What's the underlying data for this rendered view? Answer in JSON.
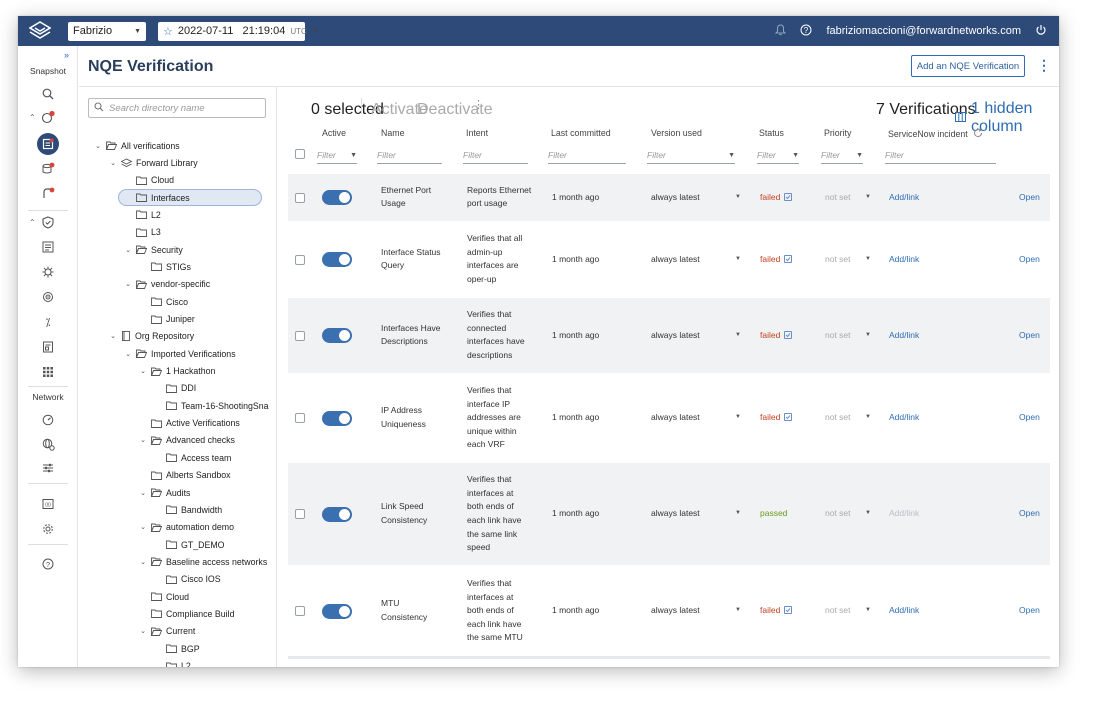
{
  "topbar": {
    "org": "Fabrizio",
    "snapshot_datetime": "2022-07-11   21:19:04",
    "snapshot_tz": "UTC",
    "user_email": "fabriziomaccioni@forwardnetworks.com"
  },
  "leftnav": {
    "snapshot_label": "Snapshot",
    "network_label": "Network"
  },
  "page": {
    "title": "NQE Verification",
    "add_button": "Add an NQE Verification"
  },
  "tree": {
    "search_placeholder": "Search directory name",
    "items": [
      {
        "label": "All verifications",
        "depth": 0,
        "chev": "down",
        "icon": "folder-open"
      },
      {
        "label": "Forward Library",
        "depth": 1,
        "chev": "down",
        "icon": "library"
      },
      {
        "label": "Cloud",
        "depth": 2,
        "chev": "",
        "icon": "folder"
      },
      {
        "label": "Interfaces",
        "depth": 2,
        "chev": "",
        "icon": "folder",
        "selected": true
      },
      {
        "label": "L2",
        "depth": 2,
        "chev": "",
        "icon": "folder"
      },
      {
        "label": "L3",
        "depth": 2,
        "chev": "",
        "icon": "folder"
      },
      {
        "label": "Security",
        "depth": 2,
        "chev": "down",
        "icon": "folder-open"
      },
      {
        "label": "STIGs",
        "depth": 3,
        "chev": "",
        "icon": "folder"
      },
      {
        "label": "vendor-specific",
        "depth": 2,
        "chev": "down",
        "icon": "folder-open"
      },
      {
        "label": "Cisco",
        "depth": 3,
        "chev": "",
        "icon": "folder"
      },
      {
        "label": "Juniper",
        "depth": 3,
        "chev": "",
        "icon": "folder"
      },
      {
        "label": "Org Repository",
        "depth": 1,
        "chev": "down",
        "icon": "repo"
      },
      {
        "label": "Imported Verifications",
        "depth": 2,
        "chev": "down",
        "icon": "folder-open"
      },
      {
        "label": "1 Hackathon",
        "depth": 3,
        "chev": "down",
        "icon": "folder-open"
      },
      {
        "label": "DDI",
        "depth": 4,
        "chev": "",
        "icon": "folder"
      },
      {
        "label": "Team-16-ShootingSna",
        "depth": 4,
        "chev": "",
        "icon": "folder"
      },
      {
        "label": "Active Verifications",
        "depth": 3,
        "chev": "",
        "icon": "folder"
      },
      {
        "label": "Advanced checks",
        "depth": 3,
        "chev": "down",
        "icon": "folder-open"
      },
      {
        "label": "Access team",
        "depth": 4,
        "chev": "",
        "icon": "folder"
      },
      {
        "label": "Alberts Sandbox",
        "depth": 3,
        "chev": "",
        "icon": "folder"
      },
      {
        "label": "Audits",
        "depth": 3,
        "chev": "down",
        "icon": "folder-open"
      },
      {
        "label": "Bandwidth",
        "depth": 4,
        "chev": "",
        "icon": "folder"
      },
      {
        "label": "automation demo",
        "depth": 3,
        "chev": "down",
        "icon": "folder-open"
      },
      {
        "label": "GT_DEMO",
        "depth": 4,
        "chev": "",
        "icon": "folder"
      },
      {
        "label": "Baseline access networks",
        "depth": 3,
        "chev": "down",
        "icon": "folder-open"
      },
      {
        "label": "Cisco IOS",
        "depth": 4,
        "chev": "",
        "icon": "folder"
      },
      {
        "label": "Cloud",
        "depth": 3,
        "chev": "",
        "icon": "folder"
      },
      {
        "label": "Compliance Build",
        "depth": 3,
        "chev": "",
        "icon": "folder"
      },
      {
        "label": "Current",
        "depth": 3,
        "chev": "down",
        "icon": "folder-open"
      },
      {
        "label": "BGP",
        "depth": 4,
        "chev": "",
        "icon": "folder"
      },
      {
        "label": "L2",
        "depth": 4,
        "chev": "",
        "icon": "folder"
      }
    ]
  },
  "toolbar": {
    "selected": "0 selected",
    "activate": "Activate",
    "deactivate": "Deactivate",
    "count": "7 Verifications",
    "hidden_columns": "1 hidden column"
  },
  "table": {
    "headers": {
      "active": "Active",
      "name": "Name",
      "intent": "Intent",
      "last_committed": "Last committed",
      "version_used": "Version used",
      "status": "Status",
      "priority": "Priority",
      "servicenow": "ServiceNow incident"
    },
    "filter_placeholder": "Filter",
    "rows": [
      {
        "name": [
          "Ethernet Port",
          "Usage"
        ],
        "intent": [
          "Reports Ethernet",
          "port usage"
        ],
        "last": "1 month ago",
        "version": "always latest",
        "status": "failed",
        "priority": "not set",
        "incident": "Add/link",
        "open": "Open"
      },
      {
        "name": [
          "Interface Status",
          "Query"
        ],
        "intent": [
          "Verifies that all",
          "admin-up",
          "interfaces are",
          "oper-up"
        ],
        "last": "1 month ago",
        "version": "always latest",
        "status": "failed",
        "priority": "not set",
        "incident": "Add/link",
        "open": "Open"
      },
      {
        "name": [
          "Interfaces Have",
          "Descriptions"
        ],
        "intent": [
          "Verifies that",
          "connected",
          "interfaces have",
          "descriptions"
        ],
        "last": "1 month ago",
        "version": "always latest",
        "status": "failed",
        "priority": "not set",
        "incident": "Add/link",
        "open": "Open"
      },
      {
        "name": [
          "IP Address",
          "Uniqueness"
        ],
        "intent": [
          "Verifies that",
          "interface IP",
          "addresses are",
          "unique within",
          "each VRF"
        ],
        "last": "1 month ago",
        "version": "always latest",
        "status": "failed",
        "priority": "not set",
        "incident": "Add/link",
        "open": "Open"
      },
      {
        "name": [
          "Link Speed",
          "Consistency"
        ],
        "intent": [
          "Verifies that",
          "interfaces at",
          "both ends of",
          "each link have",
          "the same link",
          "speed"
        ],
        "last": "1 month ago",
        "version": "always latest",
        "status": "passed",
        "priority": "not set",
        "incident": "Add/link",
        "open": "Open"
      },
      {
        "name": [
          "MTU",
          "Consistency"
        ],
        "intent": [
          "Verifies that",
          "interfaces at",
          "both ends of",
          "each link have",
          "the same MTU"
        ],
        "last": "1 month ago",
        "version": "always latest",
        "status": "failed",
        "priority": "not set",
        "incident": "Add/link",
        "open": "Open"
      }
    ]
  },
  "colors": {
    "topbar": "#2d4a78",
    "accent": "#2e6db4",
    "failed": "#c2421f",
    "passed": "#6a9a1f"
  }
}
